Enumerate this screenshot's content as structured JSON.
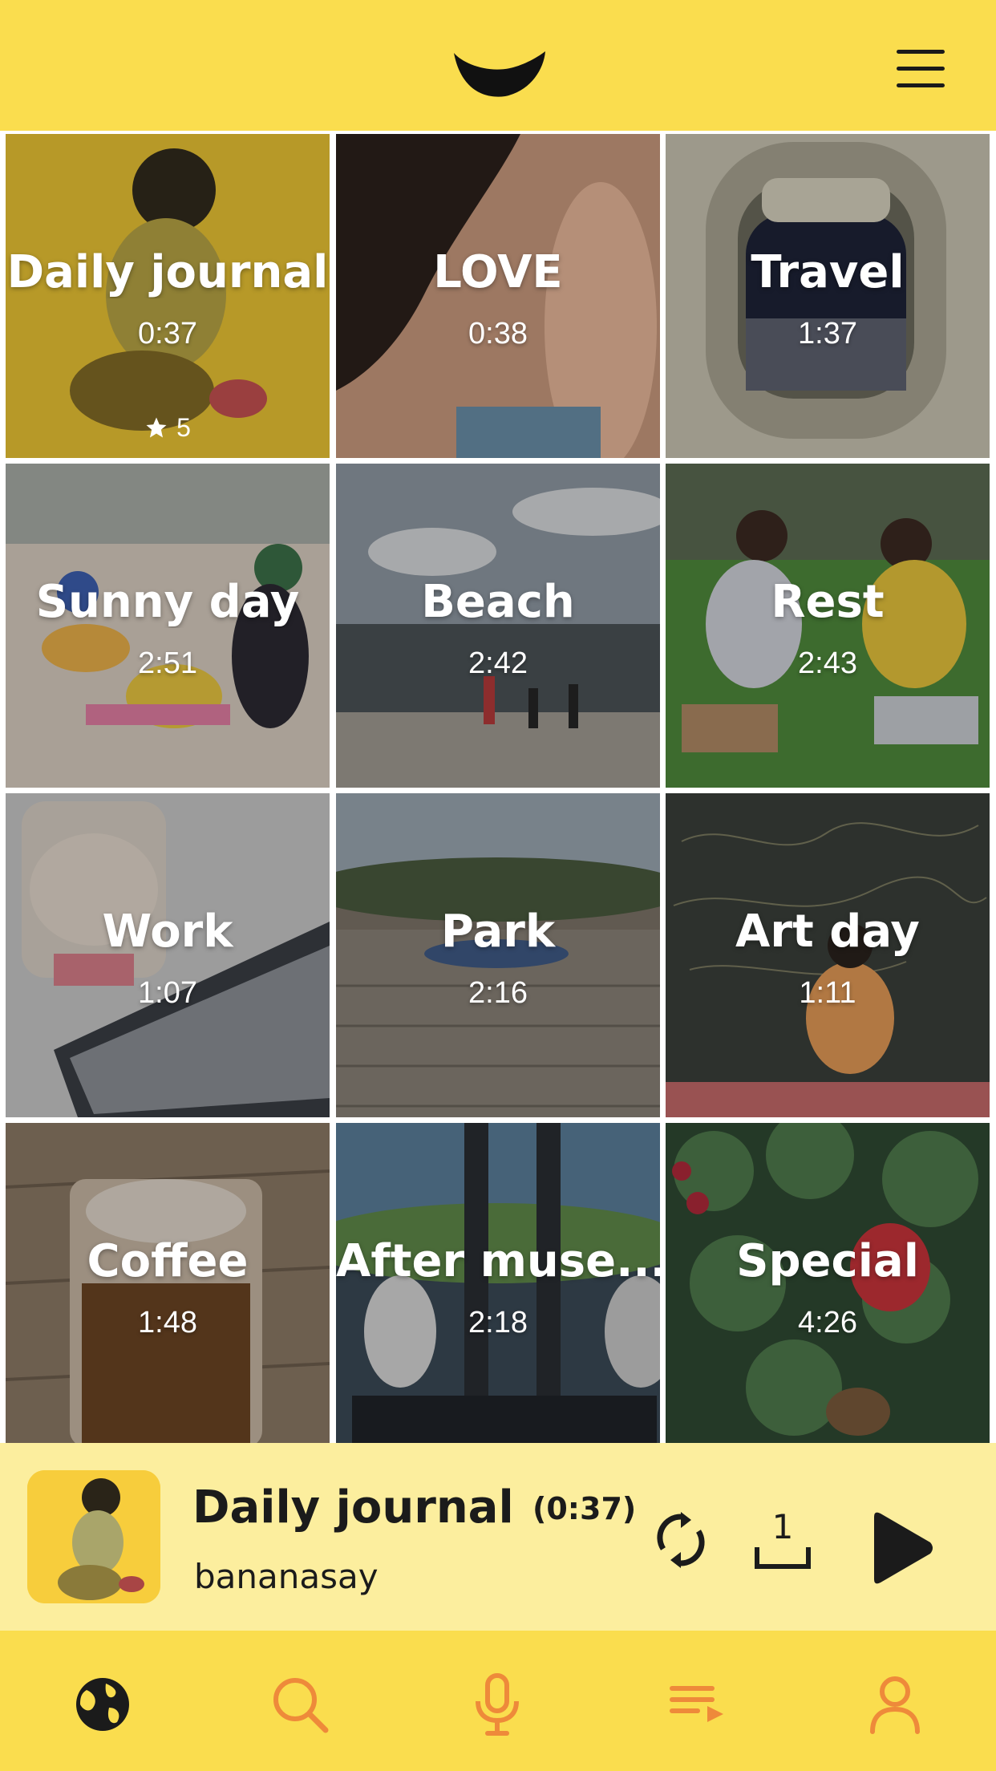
{
  "app": {
    "logo_icon": "banana-logo-icon",
    "menu_icon": "hamburger-menu-icon"
  },
  "tiles": [
    {
      "title": "Daily journal",
      "duration": "0:37",
      "likes": "5"
    },
    {
      "title": "LOVE",
      "duration": "0:38"
    },
    {
      "title": "Travel",
      "duration": "1:37"
    },
    {
      "title": "Sunny day",
      "duration": "2:51"
    },
    {
      "title": "Beach",
      "duration": "2:42"
    },
    {
      "title": "Rest",
      "duration": "2:43"
    },
    {
      "title": "Work",
      "duration": "1:07"
    },
    {
      "title": "Park",
      "duration": "2:16"
    },
    {
      "title": "Art day",
      "duration": "1:11"
    },
    {
      "title": "Coffee",
      "duration": "1:48"
    },
    {
      "title": "After muse...",
      "duration": "2:18"
    },
    {
      "title": "Special",
      "duration": "4:26"
    }
  ],
  "player": {
    "title": "Daily journal",
    "duration": "(0:37)",
    "artist": "bananasay",
    "queue_count": "1",
    "icons": [
      "repeat-icon",
      "queue-count-icon",
      "play-icon"
    ]
  },
  "nav": {
    "items": [
      "globe-icon",
      "search-icon",
      "microphone-icon",
      "playlist-icon",
      "profile-icon"
    ]
  },
  "colors": {
    "brand_yellow": "#FADD4E",
    "player_bg": "#FCEE9E",
    "nav_active": "#1b1b1b",
    "nav_inactive": "#EE8A3A"
  }
}
